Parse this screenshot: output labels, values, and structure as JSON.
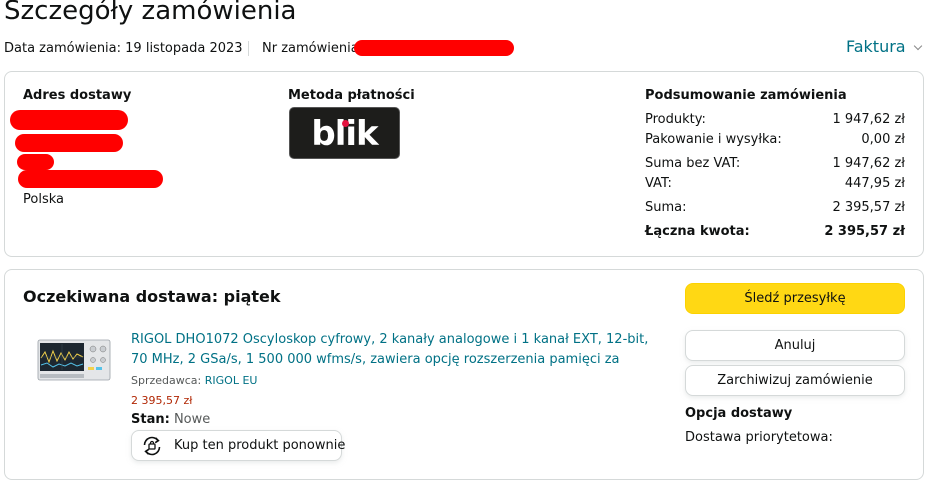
{
  "header": {
    "title": "Szczegóły zamówienia",
    "order_date": "Data zamówienia: 19 listopada 2023",
    "order_number_label": "Nr zamówienia",
    "invoice_link": "Faktura",
    "invoice_chevron_icon": "chevron-down-icon"
  },
  "summary_card": {
    "shipping": {
      "heading": "Adres dostawy",
      "country": "Polska"
    },
    "payment": {
      "heading": "Metoda płatności",
      "logo_text": "blik",
      "logo_accent_color": "#e4133f"
    },
    "order_summary": {
      "heading": "Podsumowanie zamówienia",
      "rows": [
        {
          "label": "Produkty:",
          "value": "1 947,62 zł"
        },
        {
          "label": "Pakowanie i wysyłka:",
          "value": "0,00 zł"
        },
        {
          "label": "Suma bez VAT:",
          "value": "1 947,62 zł"
        },
        {
          "label": "VAT:",
          "value": "447,95 zł"
        },
        {
          "label": "Suma:",
          "value": "2 395,57 zł"
        },
        {
          "label": "Łączna kwota:",
          "value": "2 395,57 zł"
        }
      ]
    }
  },
  "delivery_card": {
    "title": "Oczekiwana dostawa: piątek",
    "buttons": {
      "track": "Śledź przesyłkę",
      "cancel": "Anuluj",
      "archive": "Zarchiwizuj zamówienie"
    },
    "product": {
      "title": "RIGOL DHO1072 Oscyloskop cyfrowy, 2 kanały analogowe i 1 kanał EXT, 12-bit, 70 MHz, 2 GSa/s, 1 500 000 wfms/s, zawiera opcję rozszerzenia pamięci za",
      "seller_label": "Sprzedawca:",
      "seller_name": "RIGOL EU",
      "price": "2 395,57 zł",
      "condition_label": "Stan:",
      "condition_value": "Nowe",
      "rebuy_label": "Kup ten produkt ponownie",
      "rebuy_icon": "rebuy-icon"
    },
    "delivery_option": {
      "heading": "Opcja dostawy",
      "value": "Dostawa priorytetowa:"
    }
  },
  "colors": {
    "link": "#007185",
    "price": "#b12704",
    "primary_button": "#ffd814",
    "border": "#d5d9d9",
    "redaction": "#ff0000"
  }
}
